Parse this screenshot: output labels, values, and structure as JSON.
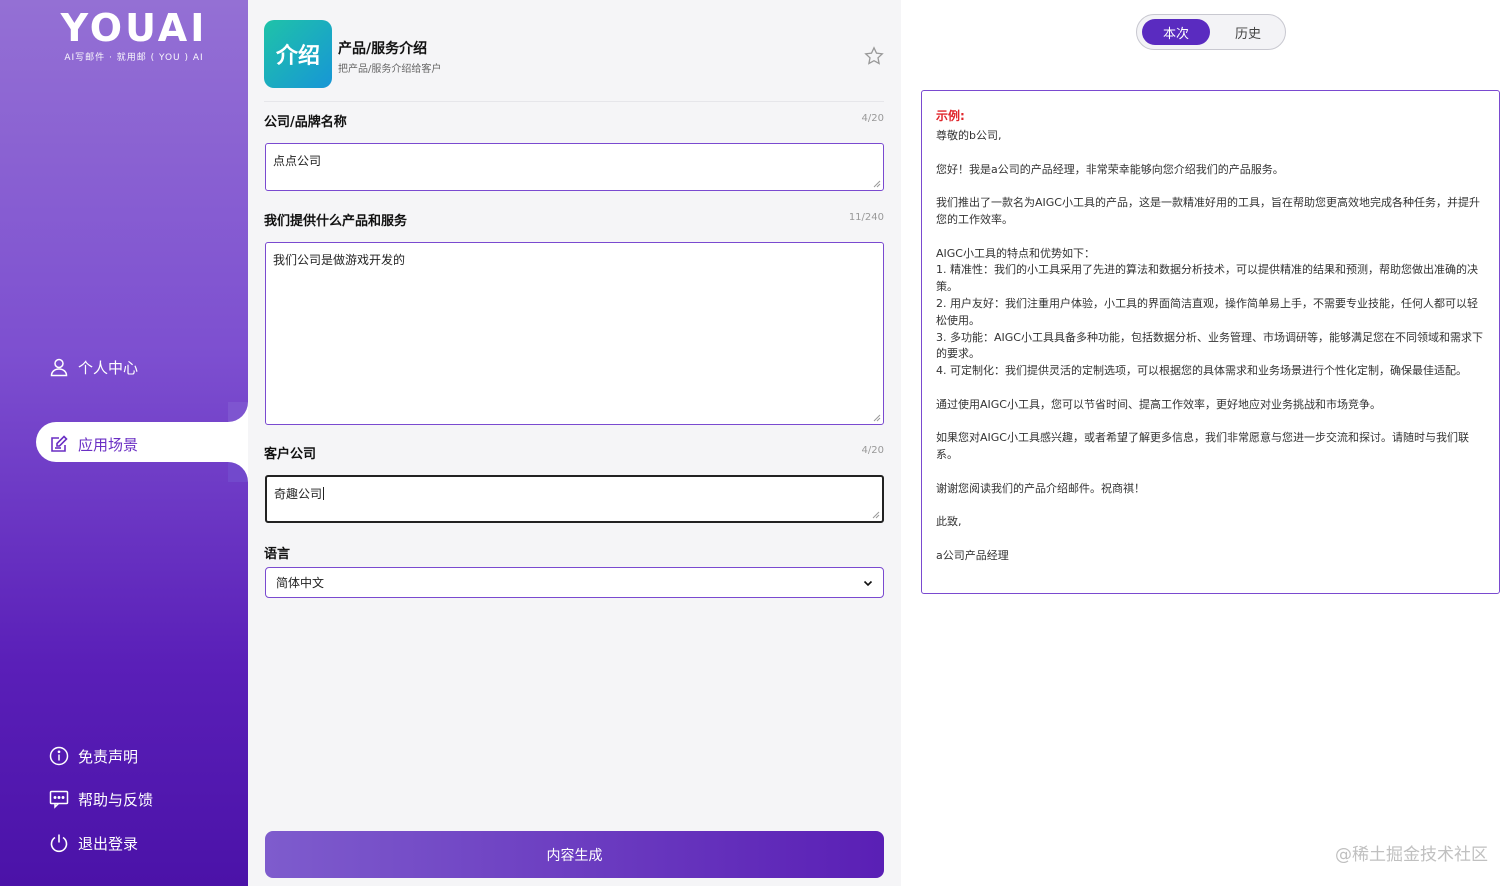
{
  "brand": {
    "logo": "YOUAI",
    "tagline": "AI写邮件 · 就用邮 ( YOU ) AI"
  },
  "sidebar": {
    "items": [
      {
        "label": "个人中心",
        "icon": "user-icon"
      },
      {
        "label": "应用场景",
        "icon": "edit-icon",
        "active": true
      }
    ],
    "bottom_items": [
      {
        "label": "免责声明",
        "icon": "info-icon"
      },
      {
        "label": "帮助与反馈",
        "icon": "chat-icon"
      },
      {
        "label": "退出登录",
        "icon": "power-icon"
      }
    ]
  },
  "app": {
    "icon_text": "介绍",
    "title": "产品/服务介绍",
    "description": "把产品/服务介绍给客户"
  },
  "form": {
    "company": {
      "label": "公司/品牌名称",
      "count": "4/20",
      "value": "点点公司"
    },
    "service": {
      "label": "我们提供什么产品和服务",
      "count": "11/240",
      "value": "我们公司是做游戏开发的"
    },
    "client": {
      "label": "客户公司",
      "count": "4/20",
      "value": "奇趣公司"
    },
    "language": {
      "label": "语言",
      "value": "简体中文"
    },
    "submit_label": "内容生成"
  },
  "tabs": {
    "current": "本次",
    "history": "历史"
  },
  "result": {
    "example_label": "示例:",
    "text": "尊敬的b公司,\n\n您好！我是a公司的产品经理，非常荣幸能够向您介绍我们的产品服务。\n\n我们推出了一款名为AIGC小工具的产品，这是一款精准好用的工具，旨在帮助您更高效地完成各种任务，并提升您的工作效率。\n\nAIGC小工具的特点和优势如下：\n1. 精准性：我们的小工具采用了先进的算法和数据分析技术，可以提供精准的结果和预测，帮助您做出准确的决策。\n2. 用户友好：我们注重用户体验，小工具的界面简洁直观，操作简单易上手，不需要专业技能，任何人都可以轻松使用。\n3. 多功能：AIGC小工具具备多种功能，包括数据分析、业务管理、市场调研等，能够满足您在不同领域和需求下的要求。\n4. 可定制化：我们提供灵活的定制选项，可以根据您的具体需求和业务场景进行个性化定制，确保最佳适配。\n\n通过使用AIGC小工具，您可以节省时间、提高工作效率，更好地应对业务挑战和市场竞争。\n\n如果您对AIGC小工具感兴趣，或者希望了解更多信息，我们非常愿意与您进一步交流和探讨。请随时与我们联系。\n\n谢谢您阅读我们的产品介绍邮件。祝商祺！\n\n此致,\n\na公司产品经理"
  },
  "watermark": "@稀土掘金技术社区",
  "colors": {
    "accent": "#5a2bc0",
    "sidebar_top": "#9470d4",
    "sidebar_bottom": "#4b12a8",
    "example_red": "#e0262c"
  }
}
